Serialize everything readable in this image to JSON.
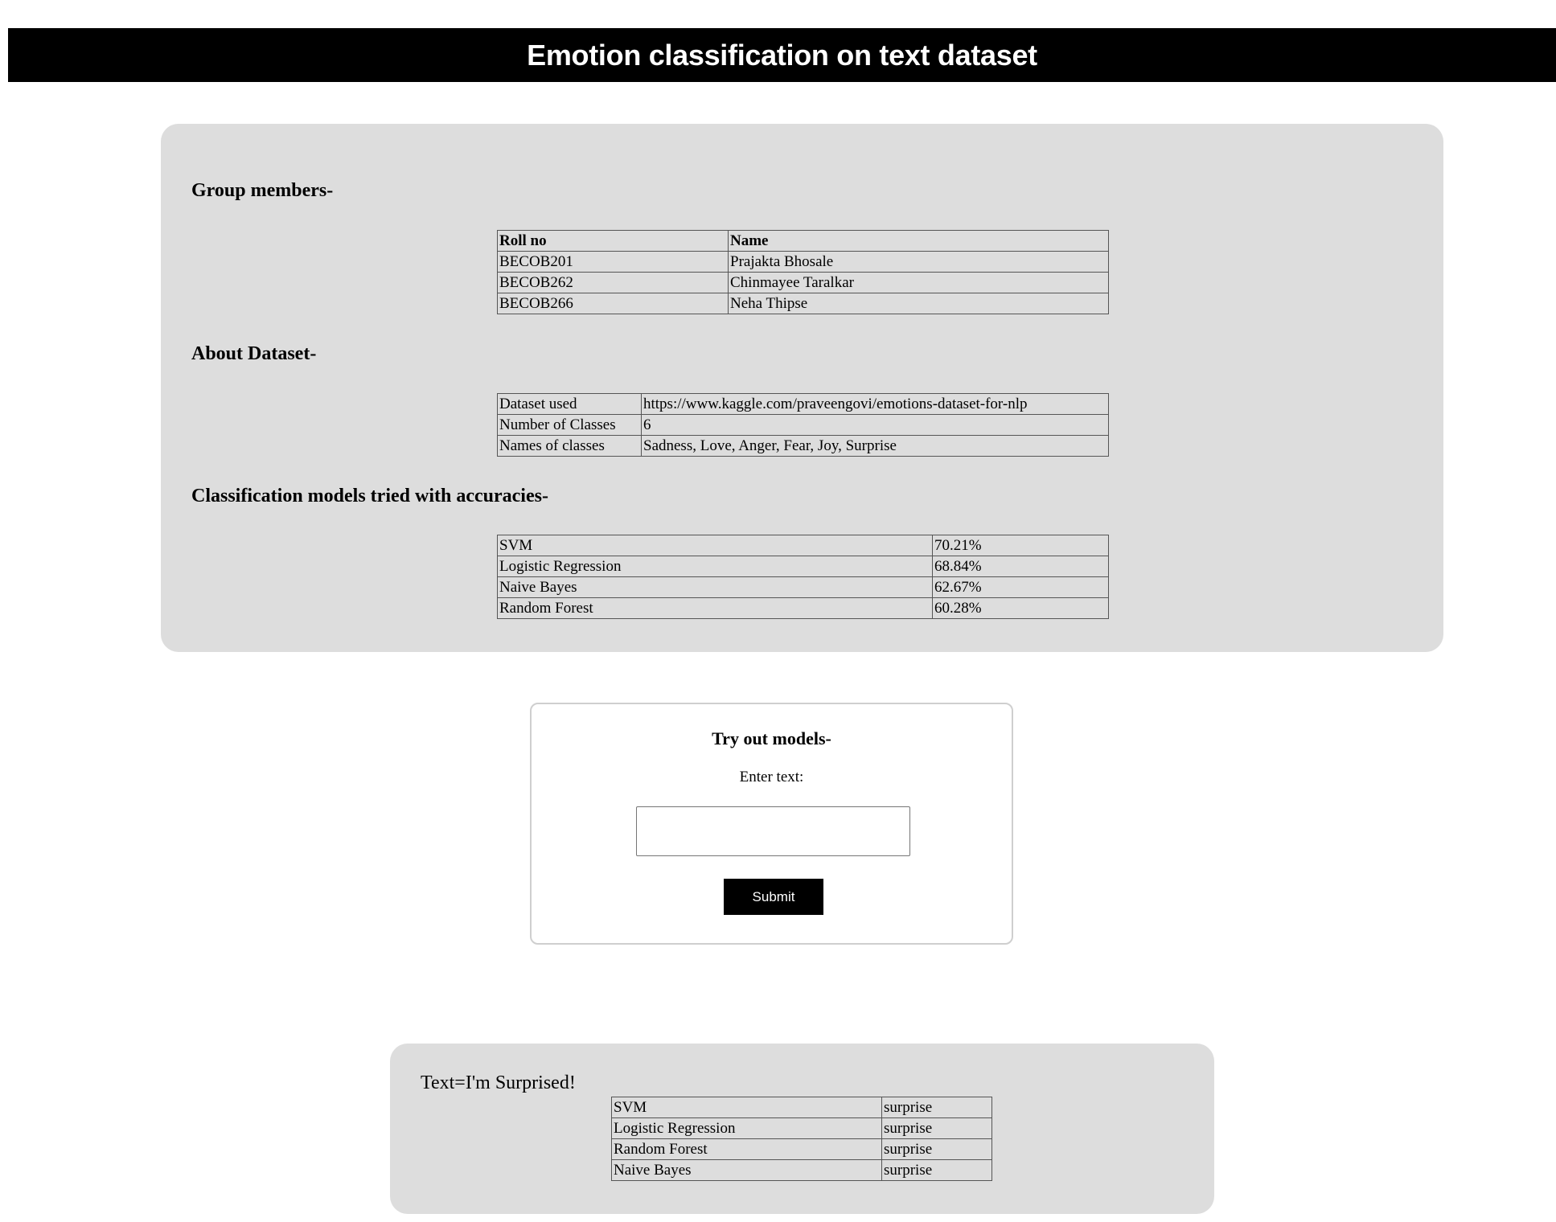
{
  "header": {
    "title": "Emotion classification on text dataset"
  },
  "group": {
    "heading": "Group members-",
    "columns": [
      "Roll no",
      "Name"
    ],
    "rows": [
      [
        "BECOB201",
        "Prajakta Bhosale"
      ],
      [
        "BECOB262",
        "Chinmayee Taralkar"
      ],
      [
        "BECOB266",
        "Neha Thipse"
      ]
    ]
  },
  "dataset": {
    "heading": "About Dataset-",
    "rows": [
      [
        "Dataset used",
        "https://www.kaggle.com/praveengovi/emotions-dataset-for-nlp"
      ],
      [
        "Number of Classes",
        "6"
      ],
      [
        "Names of classes",
        "Sadness, Love, Anger, Fear, Joy, Surprise"
      ]
    ]
  },
  "models": {
    "heading": "Classification models tried with accuracies-",
    "rows": [
      [
        "SVM",
        "70.21%"
      ],
      [
        "Logistic Regression",
        "68.84%"
      ],
      [
        "Naive Bayes",
        "62.67%"
      ],
      [
        "Random Forest",
        "60.28%"
      ]
    ]
  },
  "tryout": {
    "heading": "Try out models-",
    "label": "Enter text:",
    "input_value": "",
    "input_placeholder": "",
    "submit_label": "Submit"
  },
  "result": {
    "text": "Text=I'm Surprised!",
    "rows": [
      [
        "SVM",
        "surprise"
      ],
      [
        "Logistic Regression",
        "surprise"
      ],
      [
        "Random Forest",
        "surprise"
      ],
      [
        "Naive Bayes",
        "surprise"
      ]
    ]
  }
}
